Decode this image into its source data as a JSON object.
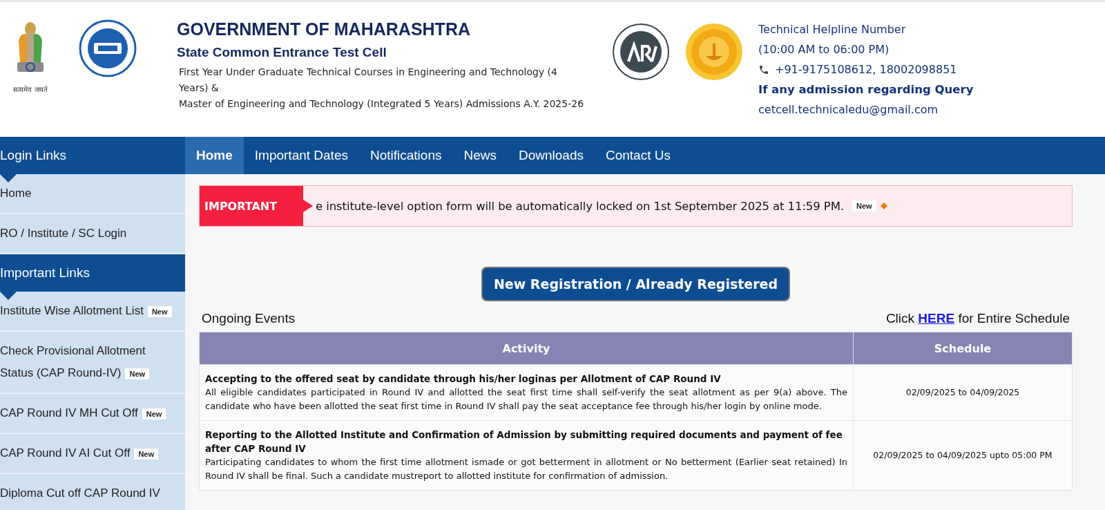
{
  "header": {
    "title": "GOVERNMENT OF MAHARASHTRA",
    "subtitle": "State Common Entrance Test Cell",
    "description": [
      "First Year Under Graduate Technical Courses in Engineering and Technology (4 Years) &",
      "Master of Engineering and Technology (Integrated 5 Years) Admissions A.Y. 2025-26"
    ],
    "emblem_motto": "सत्यमेव जयते",
    "helpline": {
      "title": "Technical Helpline Number",
      "hours": "(10:00 AM to 06:00 PM)",
      "phone": "+91-9175108612, 18002098851",
      "query_label": "If any admission regarding Query",
      "email": "cetcell.technicaledu@gmail.com"
    }
  },
  "nav": [
    {
      "label": "Home",
      "selected": true
    },
    {
      "label": "Important Dates",
      "selected": false
    },
    {
      "label": "Notifications",
      "selected": false
    },
    {
      "label": "News",
      "selected": false
    },
    {
      "label": "Downloads",
      "selected": false
    },
    {
      "label": "Contact Us",
      "selected": false
    }
  ],
  "sidebar": [
    {
      "title": "Login Links",
      "items": [
        {
          "label": "Home"
        },
        {
          "label": "RO / Institute / SC Login"
        }
      ]
    },
    {
      "title": "Important Links",
      "items": [
        {
          "label": "Institute Wise Allotment List",
          "badge": "New"
        },
        {
          "label": "Check Provisional Allotment Status (CAP Round-IV)",
          "badge": "New"
        },
        {
          "label": "CAP Round IV MH Cut Off",
          "badge": "New"
        },
        {
          "label": "CAP Round IV AI Cut Off",
          "badge": "New"
        },
        {
          "label": "Diploma Cut off CAP Round IV"
        }
      ]
    }
  ],
  "ticker": {
    "label": "IMPORTANT",
    "text": "e institute-level option form will be automatically locked on 1st September 2025 at 11:59 PM.",
    "badge": "New"
  },
  "register_button": "New Registration / Already Registered",
  "events": {
    "title": "Ongoing Events",
    "schedule_link": {
      "before": "Click",
      "link": "HERE",
      "after": "for Entire Schedule"
    },
    "columns": [
      "Activity",
      "Schedule"
    ],
    "rows": [
      {
        "title": "Accepting to the offered seat by candidate through his/her loginas per Allotment of CAP Round IV",
        "details": "All eligible candidates participated in Round IV and allotted the seat first time shall self-verify the seat allotment as per 9(a) above. The candidate who have been allotted the seat first time in Round IV shall pay the seat acceptance fee through his/her login by online mode.",
        "schedule": "02/09/2025 to 04/09/2025"
      },
      {
        "title": "Reporting to the Allotted Institute and Confirmation of Admission by submitting required documents and payment of fee after CAP Round IV",
        "details": "Participating candidates to whom the first time allotment ismade or got betterment in allotment or No betterment (Earlier seat retained) In Round IV shall be final. Such a candidate mustreport to allotted institute for confirmation of admission.",
        "schedule": "02/09/2025 to 04/09/2025 upto 05:00 PM"
      }
    ]
  }
}
